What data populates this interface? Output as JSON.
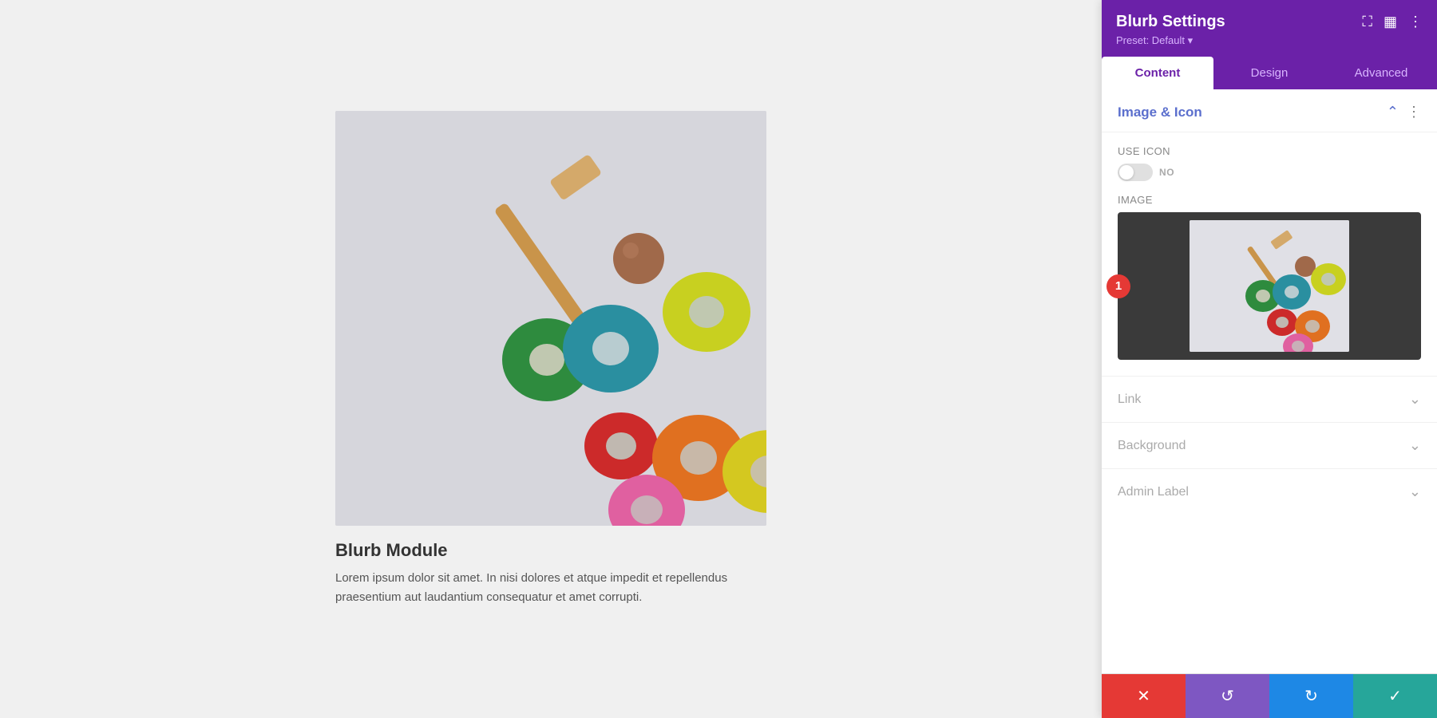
{
  "panel": {
    "title": "Blurb Settings",
    "preset": "Preset: Default",
    "tabs": [
      {
        "label": "Content",
        "active": true
      },
      {
        "label": "Design",
        "active": false
      },
      {
        "label": "Advanced",
        "active": false
      }
    ],
    "section_image_icon": {
      "title": "Image & Icon",
      "use_icon_label": "Use Icon",
      "toggle_state": "NO",
      "image_label": "Image"
    },
    "link_section": {
      "label": "Link"
    },
    "background_section": {
      "label": "Background"
    },
    "admin_label_section": {
      "label": "Admin Label"
    },
    "footer": {
      "cancel_label": "✕",
      "undo_label": "↺",
      "redo_label": "↻",
      "save_label": "✓"
    }
  },
  "blurb": {
    "title": "Blurb Module",
    "text": "Lorem ipsum dolor sit amet. In nisi dolores et atque impedit et repellendus praesentium aut laudantium consequatur et amet corrupti."
  },
  "badge": {
    "number": "1"
  }
}
